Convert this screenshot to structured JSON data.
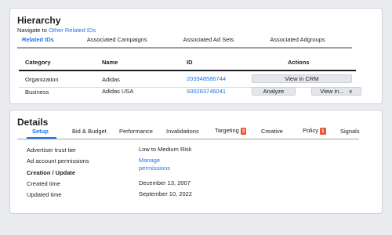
{
  "hierarchy": {
    "title": "Hierarchy",
    "navigate_prefix": "Navigate to",
    "navigate_link": "Other Related IDs",
    "tabs": [
      {
        "label": "Related IDs",
        "active": true
      },
      {
        "label": "Associated Campaigns",
        "active": false
      },
      {
        "label": "Associated Ad Sets",
        "active": false
      },
      {
        "label": "Associated Adgroups",
        "active": false
      }
    ],
    "table": {
      "columns": [
        "Category",
        "Name",
        "ID",
        "Actions"
      ],
      "rows": [
        {
          "category": "Organization",
          "name": "Adidas",
          "id": "203948586744",
          "actions": [
            "View in CRM"
          ]
        },
        {
          "category": "Business",
          "name": "Adidas USA",
          "id": "930283746041",
          "actions": [
            "Analyze",
            "View in..."
          ]
        }
      ]
    }
  },
  "details": {
    "title": "Details",
    "tabs": [
      {
        "label": "Setup",
        "active": true
      },
      {
        "label": "Bid & Budget"
      },
      {
        "label": "Performance"
      },
      {
        "label": "Invalidations"
      },
      {
        "label": "Targeting",
        "badge": "3"
      },
      {
        "label": "Creative"
      },
      {
        "label": "Policy",
        "badge": "1"
      },
      {
        "label": "Signals"
      }
    ],
    "fields": {
      "trust_label": "Advertiser trust tier",
      "trust_value": "Low to Medium Risk",
      "permissions_label": "Ad account permissions",
      "permissions_link_line1": "Manage",
      "permissions_link_line2": "permissions",
      "section_label": "Creation / Update",
      "created_label": "Created time",
      "created_value": "December 13, 2007",
      "updated_label": "Updated time",
      "updated_value": "September 10, 2022"
    }
  },
  "colors": {
    "accent": "#1877f2",
    "badge": "#e4593a",
    "background": "#e9ebee"
  },
  "icons": {
    "dropdown": "chevron-down-icon"
  }
}
